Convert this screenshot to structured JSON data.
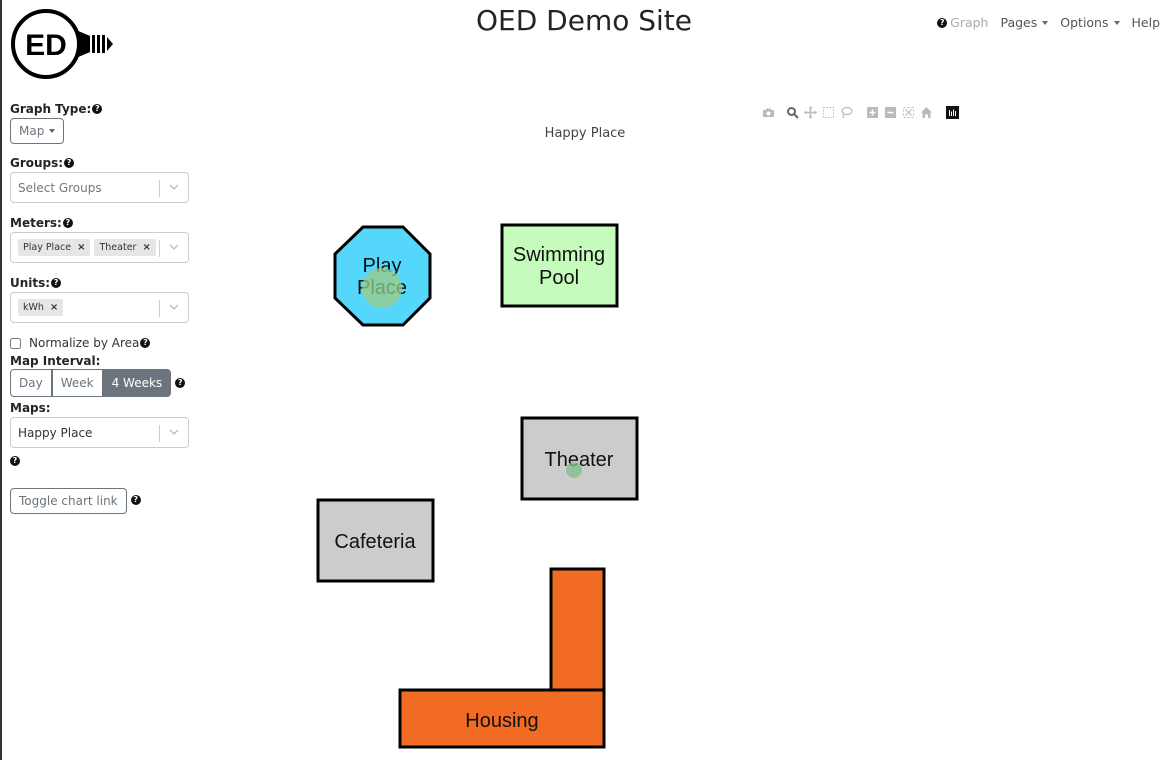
{
  "header": {
    "logo_text": "ED",
    "site_title": "OED Demo Site",
    "nav": {
      "graph": "Graph",
      "pages": "Pages",
      "options": "Options",
      "help": "Help"
    }
  },
  "sidebar": {
    "graph_type": {
      "label": "Graph Type:",
      "value": "Map"
    },
    "groups": {
      "label": "Groups:",
      "placeholder": "Select Groups"
    },
    "meters": {
      "label": "Meters:",
      "selected": [
        "Play Place",
        "Theater"
      ]
    },
    "units": {
      "label": "Units:",
      "selected": [
        "kWh"
      ]
    },
    "normalize": {
      "label": "Normalize by Area",
      "checked": false
    },
    "map_interval": {
      "label": "Map Interval:",
      "options": [
        "Day",
        "Week",
        "4 Weeks"
      ],
      "active": "4 Weeks"
    },
    "maps": {
      "label": "Maps:",
      "value": "Happy Place"
    },
    "toggle_chart_link": "Toggle chart link"
  },
  "toolbar": {
    "icons": [
      "camera-icon",
      "zoom-icon",
      "pan-icon",
      "box-select-icon",
      "lasso-select-icon",
      "zoom-in-icon",
      "zoom-out-icon",
      "autoscale-icon",
      "reset-axes-icon",
      "plotly-logo-icon"
    ]
  },
  "map": {
    "title": "Happy Place",
    "buildings": [
      {
        "name": "Play Place",
        "line1": "Play",
        "line2": "Place",
        "color": "#55d6fb",
        "shape": "octagon"
      },
      {
        "name": "Swimming Pool",
        "line1": "Swimming",
        "line2": "Pool",
        "color": "#c5fbbb",
        "shape": "rect"
      },
      {
        "name": "Theater",
        "line1": "Theater",
        "line2": "",
        "color": "#cccccc",
        "shape": "rect"
      },
      {
        "name": "Cafeteria",
        "line1": "Cafeteria",
        "line2": "",
        "color": "#cccccc",
        "shape": "rect"
      },
      {
        "name": "Housing",
        "line1": "Housing",
        "line2": "",
        "color": "#f26b22",
        "shape": "L"
      }
    ],
    "markers": [
      {
        "meter": "Play Place",
        "color": "#9ccc84",
        "size": "large"
      },
      {
        "meter": "Theater",
        "color": "#7fbf8a",
        "size": "small"
      }
    ]
  }
}
